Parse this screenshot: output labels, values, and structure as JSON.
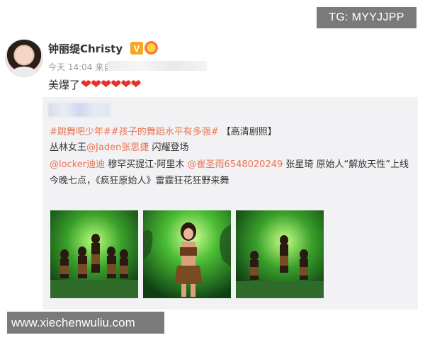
{
  "watermarks": {
    "top_right": "TG: MYYJJPP",
    "bottom_left": "www.xiechenwuliu.com"
  },
  "post": {
    "username": "钟丽缇Christy",
    "vip_badge": "V",
    "time": "今天 14:04 来自",
    "text": "美爆了",
    "hearts": "❤❤❤❤❤❤"
  },
  "repost": {
    "hashtags": [
      {
        "label": "#跳舞吧少年#"
      },
      {
        "label": "#孩子的舞蹈水平有多强#"
      }
    ],
    "tag_suffix": "【高清剧照】",
    "line2_prefix": "丛林女王",
    "line2_mention": "@Jaden张思捷",
    "line2_suffix": "闪耀登场",
    "line3_mention1": "@locker迪迪",
    "line3_text1": "穆罕买提江·阿里木",
    "line3_mention2": "@崔圣雨6548020249",
    "line3_text2": "张星琦 原始人“解放天性”上线",
    "line4": "今晚七点，《疯狂原始人》雷霆狂花狂野来舞",
    "photos": [
      {
        "name": "photo-group-dance-1"
      },
      {
        "name": "photo-solo-dancer"
      },
      {
        "name": "photo-group-dance-2"
      }
    ]
  },
  "colors": {
    "link": "#eb7350",
    "heart": "#e8302c",
    "watermark_bg": "#7a7a7a",
    "repost_bg": "#f2f2f5"
  }
}
